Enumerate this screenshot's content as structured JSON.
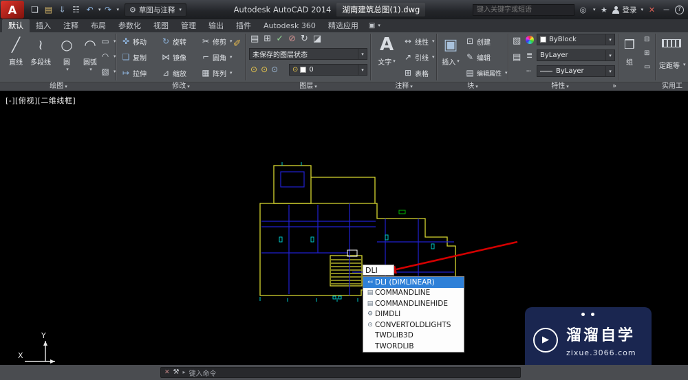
{
  "titlebar": {
    "workspace": "草图与注释",
    "app_title": "Autodesk AutoCAD 2014",
    "doc_title": "湖南建筑总图(1).dwg",
    "search_placeholder": "键入关键字或短语",
    "signin_label": "登录",
    "logo_letter": "A"
  },
  "tabs": [
    {
      "label": "默认"
    },
    {
      "label": "插入"
    },
    {
      "label": "注释"
    },
    {
      "label": "布局"
    },
    {
      "label": "参数化"
    },
    {
      "label": "视图"
    },
    {
      "label": "管理"
    },
    {
      "label": "输出"
    },
    {
      "label": "插件"
    },
    {
      "label": "Autodesk 360"
    },
    {
      "label": "精选应用"
    }
  ],
  "panels": {
    "draw": {
      "label": "绘图",
      "tools": [
        {
          "label": "直线"
        },
        {
          "label": "多段线"
        },
        {
          "label": "圆"
        },
        {
          "label": "圆弧"
        }
      ]
    },
    "modify": {
      "label": "修改",
      "tools": [
        {
          "label": "移动"
        },
        {
          "label": "旋转"
        },
        {
          "label": "修剪"
        },
        {
          "label": "复制"
        },
        {
          "label": "镜像"
        },
        {
          "label": "圆角"
        },
        {
          "label": "拉伸"
        },
        {
          "label": "缩放"
        },
        {
          "label": "阵列"
        }
      ]
    },
    "layers": {
      "label": "图层",
      "layer_state": "未保存的图层状态",
      "current_layer": "0"
    },
    "annotation": {
      "label": "注释",
      "text_tool": "文字",
      "rows": [
        {
          "label": "线性"
        },
        {
          "label": "引线"
        },
        {
          "label": "表格"
        }
      ]
    },
    "block": {
      "label": "块",
      "insert_tool": "插入",
      "rows": [
        {
          "label": "创建"
        },
        {
          "label": "编辑"
        },
        {
          "label": "编辑属性"
        }
      ]
    },
    "properties": {
      "label": "特性",
      "rows": [
        {
          "value": "ByBlock"
        },
        {
          "value": "ByLayer"
        },
        {
          "value": "ByLayer"
        }
      ]
    },
    "group": {
      "label": "组"
    },
    "utilities": {
      "label": "实用工",
      "tool": "定距等"
    }
  },
  "viewport": {
    "controls": "[-][俯视][二维线框]",
    "ucs_x": "X",
    "ucs_y": "Y"
  },
  "command_popup": {
    "input_value": "DLI",
    "items": [
      {
        "glyph": "↤",
        "label": "DLI (DIMLINEAR)",
        "selected": true
      },
      {
        "glyph": "▤",
        "label": "COMMANDLINE",
        "selected": false
      },
      {
        "glyph": "▤",
        "label": "COMMANDLINEHIDE",
        "selected": false
      },
      {
        "glyph": "⚙",
        "label": "DIMDLI",
        "selected": false
      },
      {
        "glyph": "⊙",
        "label": "CONVERTOLDLIGHTS",
        "selected": false
      },
      {
        "glyph": "",
        "label": "TWDLIB3D",
        "selected": false
      },
      {
        "glyph": "",
        "label": "TWORDLIB",
        "selected": false
      }
    ]
  },
  "command_bar": {
    "prompt": "键入命令"
  },
  "watermark": {
    "brand": "溜溜自学",
    "url": "zixue.3066.com"
  },
  "colors": {
    "selection_blue": "#2e80d8",
    "plan_outline_yellow": "#d8d830",
    "plan_line_blue": "#2020d0",
    "plan_mark_cyan": "#00c8c8",
    "arrow_red": "#d40000",
    "watermark_navy": "#1a2650"
  },
  "icons": {
    "caret-down": "▾",
    "caret-right": "▸",
    "new-file": "❏",
    "open-folder": "▤",
    "save": "⇓",
    "print": "☷",
    "undo": "↶",
    "redo": "↷",
    "gear": "⚙",
    "binoculars": "◎",
    "star": "★",
    "close": "✕",
    "minimize": "－",
    "help": "?",
    "line": "╱",
    "polyline": "≀",
    "circle": "○",
    "arc": "◠",
    "move": "✜",
    "rotate": "↻",
    "trim": "✂",
    "copy": "❏",
    "mirror": "⋈",
    "fillet": "⌐",
    "stretch": "↦",
    "scale": "⊿",
    "array": "▦",
    "marker": "✎",
    "layer-props": "▤",
    "layer-check": "✓",
    "layer-off": "⊘",
    "layer-refresh": "↻",
    "layer-grid": "⊞",
    "layer-new": "◪",
    "bulb": "⊙",
    "text-tool": "A",
    "linear-dim": "↔",
    "leader": "↗",
    "table": "⊞",
    "block-insert": "▣",
    "block-create": "⊡",
    "edit-pencil": "✎",
    "attributes": "▤",
    "lineweight": "≣",
    "linetype": "┄",
    "match-props": "▧",
    "group": "❒",
    "group-edit": "⊟",
    "group-sel": "⊞",
    "group-box": "▭",
    "wrench": "⚒",
    "prompt-x": "✕",
    "ribbon-options": "▣",
    "play": "▶"
  }
}
